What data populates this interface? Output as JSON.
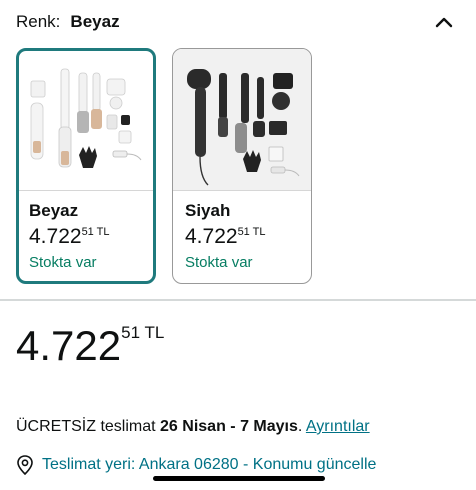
{
  "variant": {
    "label": "Renk:",
    "selected": "Beyaz"
  },
  "swatches": [
    {
      "name": "Beyaz",
      "price_main": "4.722",
      "price_fraction": "51",
      "currency": "TL",
      "stock": "Stokta var"
    },
    {
      "name": "Siyah",
      "price_main": "4.722",
      "price_fraction": "51",
      "currency": "TL",
      "stock": "Stokta var"
    }
  ],
  "price": {
    "main": "4.722",
    "fraction": "51",
    "currency": "TL"
  },
  "delivery": {
    "prefix": "ÜCRETSİZ teslimat",
    "dates": "26 Nisan - 7 Mayıs",
    "suffix": ".",
    "details_link": "Ayrıntılar"
  },
  "location": {
    "text": "Teslimat yeri: Ankara 06280 - Konumu güncelle"
  },
  "colors": {
    "selected_border": "#1f7a7d",
    "stock_green": "#067d62",
    "link_teal": "#007185"
  },
  "icons": {
    "collapse": "chevron-up-icon",
    "location": "location-pin-icon"
  }
}
